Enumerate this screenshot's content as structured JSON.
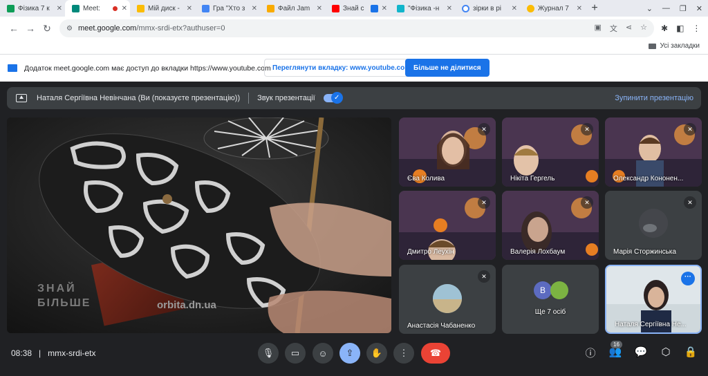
{
  "browser": {
    "tabs": [
      {
        "title": "Фізика 7 к",
        "color": "#0f9d58"
      },
      {
        "title": "Meet: ",
        "color": "#00897b",
        "active": true
      },
      {
        "title": "Мій диск -",
        "color": "#fbbc04"
      },
      {
        "title": "Гра \"Хто з",
        "color": "#4285f4"
      },
      {
        "title": "Файл Jam",
        "color": "#f9ab00"
      },
      {
        "title": "Знай с",
        "color": "#ff0000"
      },
      {
        "title": "\"Фізика -н",
        "color": "#12b5cb"
      },
      {
        "title": "зірки в рі",
        "color": "#4285f4"
      },
      {
        "title": "Журнал 7",
        "color": "#fbbc04"
      }
    ],
    "new_tab": "+",
    "url_domain": "meet.google.com",
    "url_path": "/mmx-srdi-etx?authuser=0",
    "bookmarks_all": "Усі закладки"
  },
  "share_notice": {
    "text": "Додаток meet.google.com має доступ до вкладки https://www.youtube.com",
    "view_tab_btn": "Переглянути вкладку: www.youtube.com",
    "stop_sharing_btn": "Більше не ділитися"
  },
  "presentation": {
    "presenter": "Наталя Сергіївна Невінчана (Ви (показуєте презентацію))",
    "audio_label": "Звук презентації",
    "stop_label": "Зупинити презентацію",
    "video_watermark_left": "ЗНАЙ БІЛЬШЕ",
    "video_watermark_right": "orbita.dn.ua"
  },
  "participants": [
    {
      "name": "Єва Колива",
      "muted": true
    },
    {
      "name": "Нікіта Гергель",
      "muted": true
    },
    {
      "name": "Олександр Кононен...",
      "muted": true
    },
    {
      "name": "Дмитро Леухін",
      "muted": true
    },
    {
      "name": "Валерія Лохбаум",
      "muted": true
    },
    {
      "name": "Марія Сторжинська",
      "muted": true
    },
    {
      "name": "Анастасія Чабаненко",
      "muted": true
    },
    {
      "name": "Ще 7 осіб",
      "muted": false,
      "avatar_letter": "В"
    },
    {
      "name": "Наталя Сергіївна Не...",
      "muted": false
    }
  ],
  "bottom": {
    "time": "08:38",
    "separator": "|",
    "code": "mmx-srdi-etx",
    "people_count": "16"
  }
}
